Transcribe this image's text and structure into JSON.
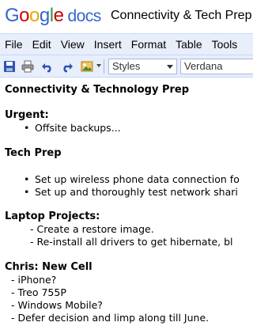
{
  "header": {
    "logo_letters": [
      "G",
      "o",
      "o",
      "g",
      "l",
      "e"
    ],
    "logo_docs": "docs",
    "doc_title": "Connectivity & Tech Prep"
  },
  "menu": [
    "File",
    "Edit",
    "View",
    "Insert",
    "Format",
    "Table",
    "Tools"
  ],
  "toolbar": {
    "styles_value": "Styles",
    "font_value": "Verdana",
    "icons": [
      "save-icon",
      "print-icon",
      "undo-icon",
      "redo-icon",
      "insert-image-icon"
    ]
  },
  "document": {
    "title": "Connectivity & Technology Prep",
    "urgent_heading": "Urgent:",
    "urgent_items": [
      "Offsite backups..."
    ],
    "tech_heading": "Tech Prep",
    "tech_items": [
      "Set up wireless phone data connection fo",
      "Set up and thoroughly test network shari"
    ],
    "laptop_heading": "Laptop Projects:",
    "laptop_items": [
      "- Create a restore image.",
      "- Re-install all drivers to get hibernate, bl"
    ],
    "chris_heading": "Chris: New Cell",
    "chris_items": [
      "- iPhone?",
      "- Treo 755P",
      "- Windows Mobile?",
      "- Defer decision and limp along till June."
    ]
  },
  "colors": {
    "menu_bg": "#e8eefa",
    "border": "#c3d9ff",
    "logo_blue": "#3366cc"
  }
}
